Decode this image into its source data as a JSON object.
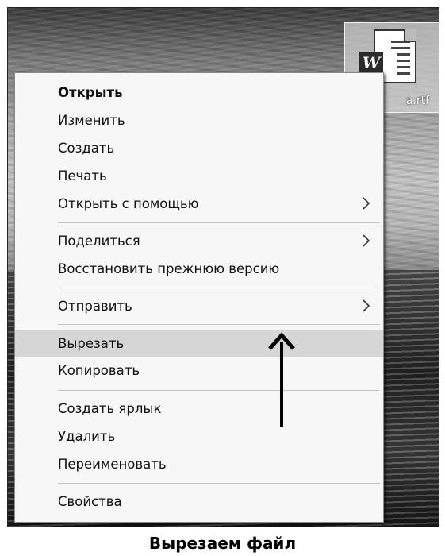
{
  "desktop": {
    "file_icon": {
      "icon": "word-document-icon",
      "badge": "W",
      "label_visible": "a.rtf"
    }
  },
  "context_menu": {
    "items": [
      {
        "label": "Открыть",
        "bold": true,
        "submenu": false
      },
      {
        "label": "Изменить",
        "submenu": false
      },
      {
        "label": "Создать",
        "submenu": false
      },
      {
        "label": "Печать",
        "submenu": false
      },
      {
        "label": "Открыть с помощью",
        "submenu": true
      },
      {
        "label": "Поделиться",
        "submenu": true
      },
      {
        "label": "Восстановить прежнюю версию",
        "submenu": false
      },
      {
        "label": "Отправить",
        "submenu": true
      },
      {
        "label": "Вырезать",
        "highlighted": true,
        "submenu": false
      },
      {
        "label": "Копировать",
        "submenu": false
      },
      {
        "label": "Создать ярлык",
        "submenu": false
      },
      {
        "label": "Удалить",
        "submenu": false
      },
      {
        "label": "Переименовать",
        "submenu": false
      },
      {
        "label": "Свойства",
        "submenu": false
      }
    ],
    "highlight_color": "#d6d6d6"
  },
  "annotation": {
    "arrow": "up-arrow",
    "points_to": "Вырезать"
  },
  "caption": "Вырезаем файл"
}
